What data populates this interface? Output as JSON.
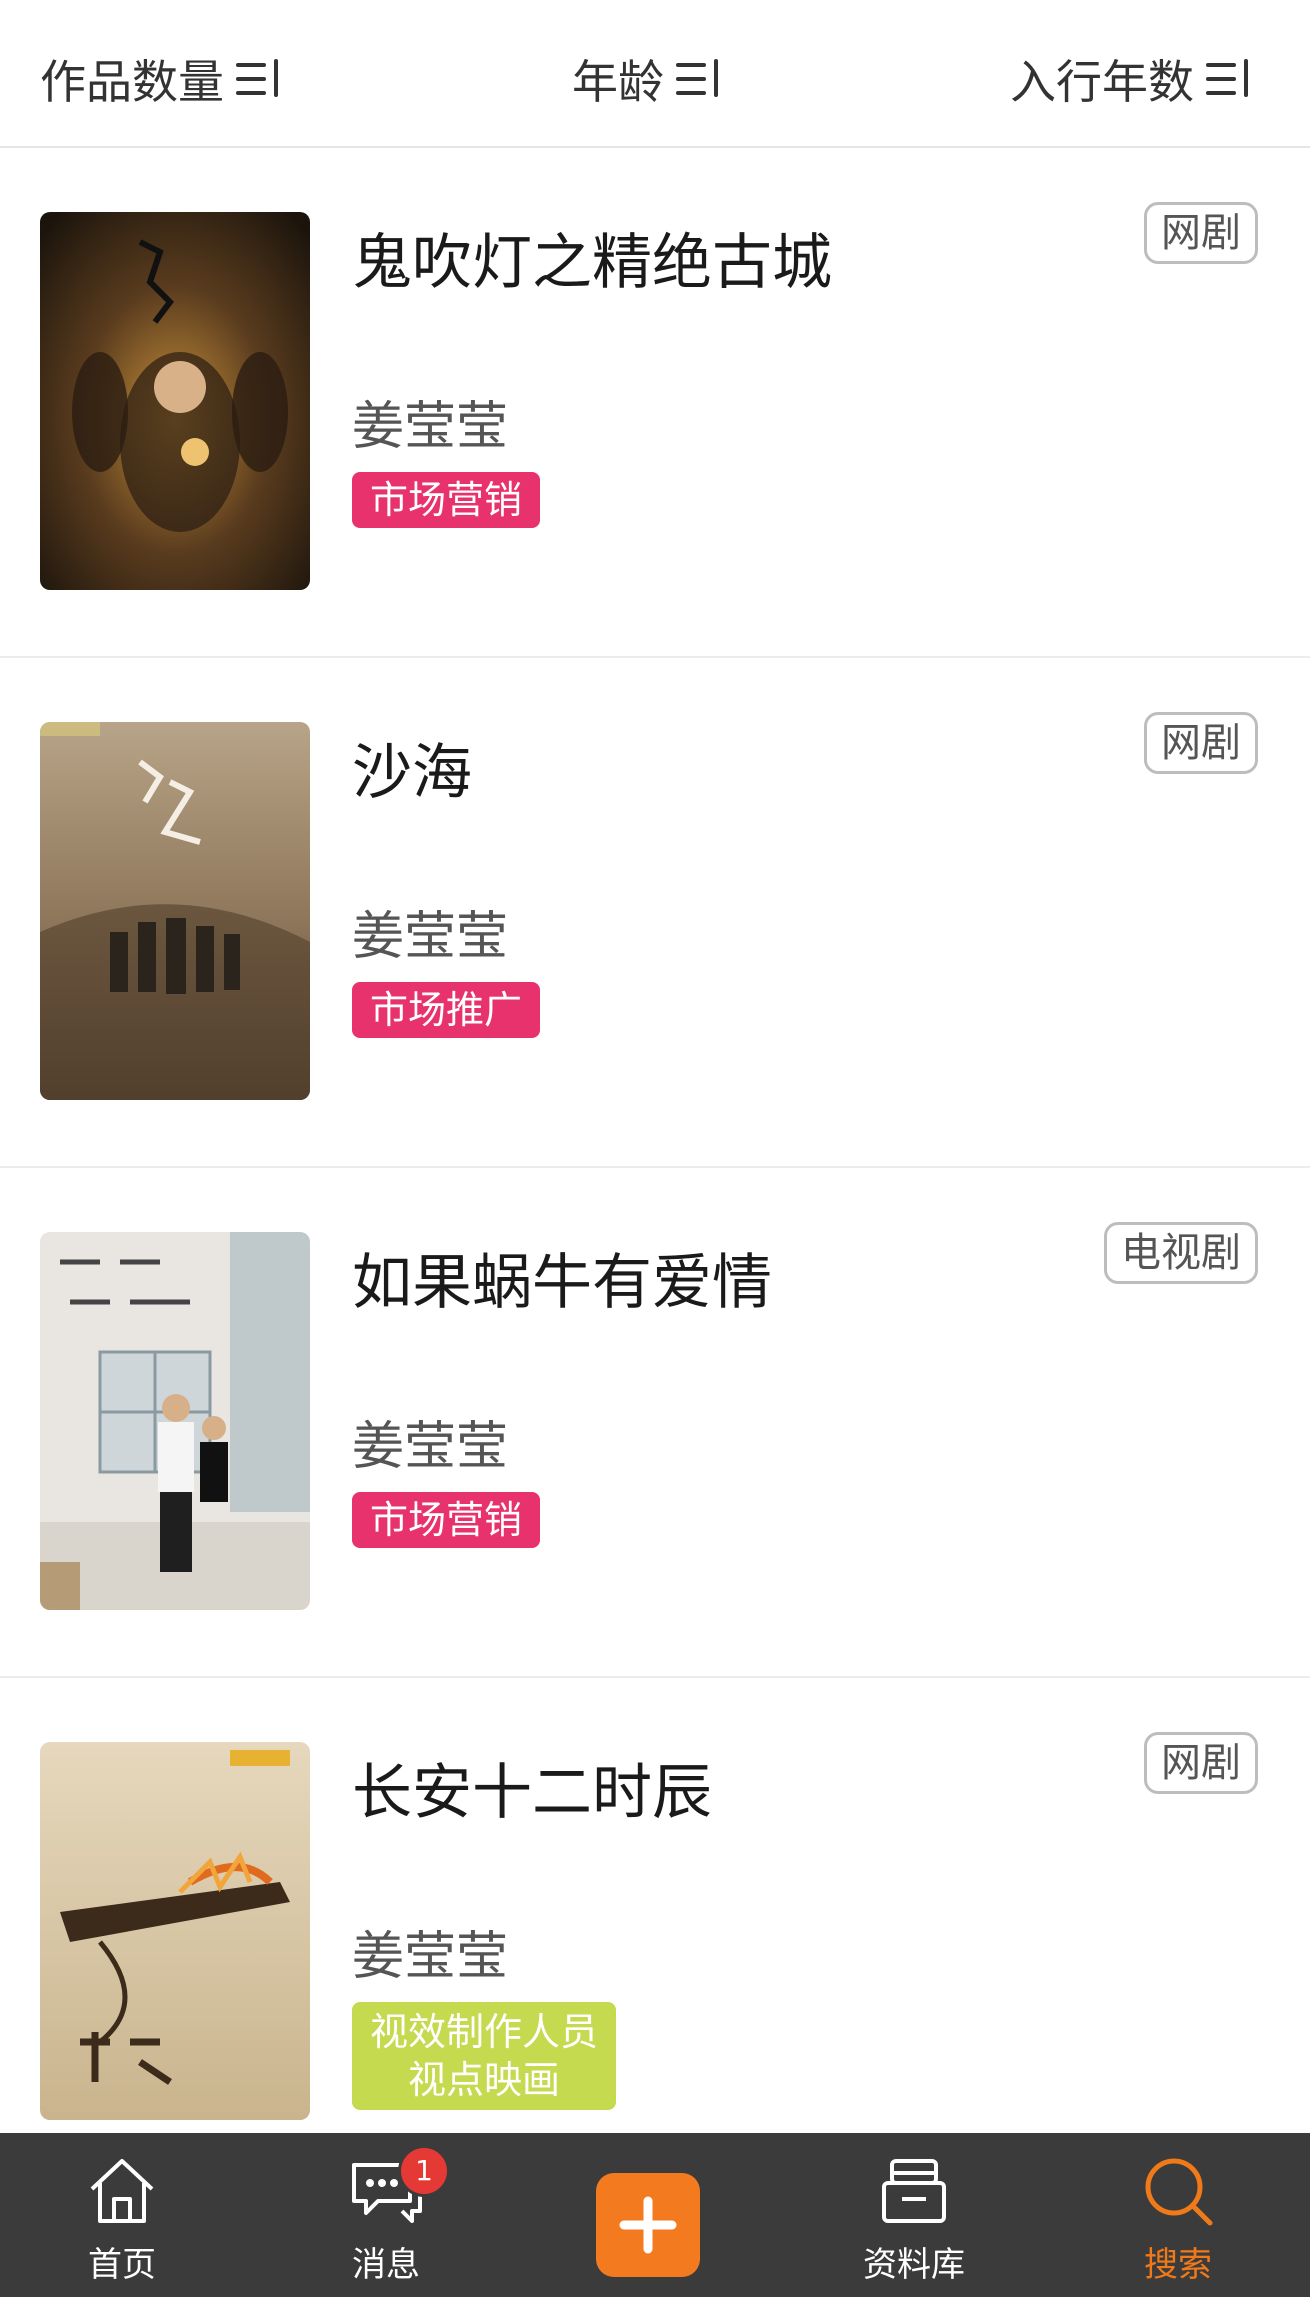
{
  "filters": [
    {
      "label": "作品数量"
    },
    {
      "label": "年龄"
    },
    {
      "label": "入行年数"
    }
  ],
  "works": [
    {
      "title": "鬼吹灯之精绝古城",
      "person": "姜莹莹",
      "role": "市场营销",
      "type": "网剧",
      "tag_color": "#e8326e"
    },
    {
      "title": "沙海",
      "person": "姜莹莹",
      "role": "市场推广",
      "type": "网剧",
      "tag_color": "#e8326e"
    },
    {
      "title": "如果蜗牛有爱情",
      "person": "姜莹莹",
      "role": "市场营销",
      "type": "电视剧",
      "tag_color": "#e8326e"
    },
    {
      "title": "长安十二时辰",
      "person": "姜莹莹",
      "role_lines": [
        "视效制作人员",
        "视点映画"
      ],
      "type": "网剧",
      "tag_color": "#c6da4f"
    }
  ],
  "nav": {
    "home": "首页",
    "messages": "消息",
    "messages_badge": "1",
    "library": "资料库",
    "search": "搜索"
  },
  "colors": {
    "accent": "#f47a20",
    "tag_pink": "#e8326e",
    "tag_yellow": "#c6da4f",
    "nav_bg": "#3b3b3b",
    "nav_active": "#f07a1a"
  },
  "icons": {
    "sort": "sort-filter-icon",
    "home": "home-icon",
    "messages": "chat-bubble-icon",
    "add": "plus-icon",
    "library": "archive-box-icon",
    "search": "search-icon"
  }
}
